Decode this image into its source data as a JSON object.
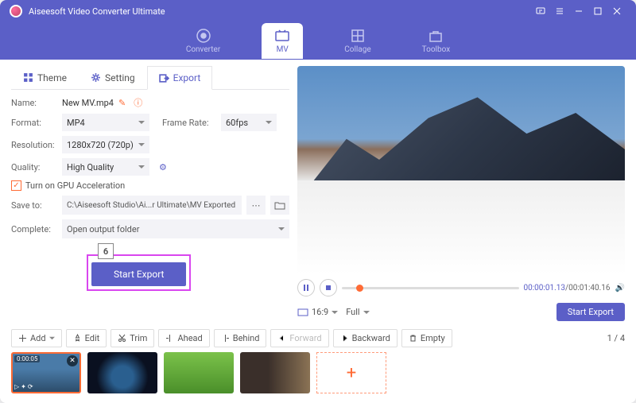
{
  "title": "Aiseesoft Video Converter Ultimate",
  "maintabs": {
    "converter": "Converter",
    "mv": "MV",
    "collage": "Collage",
    "toolbox": "Toolbox"
  },
  "subtabs": {
    "theme": "Theme",
    "setting": "Setting",
    "export": "Export"
  },
  "form": {
    "name_lbl": "Name:",
    "name_val": "New MV.mp4",
    "format_lbl": "Format:",
    "format_val": "MP4",
    "framerate_lbl": "Frame Rate:",
    "framerate_val": "60fps",
    "resolution_lbl": "Resolution:",
    "resolution_val": "1280x720 (720p)",
    "quality_lbl": "Quality:",
    "quality_val": "High Quality",
    "gpu_lbl": "Turn on GPU Acceleration",
    "saveto_lbl": "Save to:",
    "saveto_val": "C:\\Aiseesoft Studio\\Ai...r Ultimate\\MV Exported",
    "complete_lbl": "Complete:",
    "complete_val": "Open output folder"
  },
  "callout_num": "6",
  "export_btn": "Start Export",
  "player": {
    "cur": "00:00:01.13",
    "total": "/00:01:40.16",
    "aspect": "16:9",
    "full": "Full"
  },
  "export2": "Start Export",
  "toolbar": {
    "add": "Add",
    "edit": "Edit",
    "trim": "Trim",
    "ahead": "Ahead",
    "behind": "Behind",
    "forward": "Forward",
    "backward": "Backward",
    "empty": "Empty"
  },
  "pager": {
    "cur": "1",
    "total": "4"
  },
  "thumb_dur": "0:00:05"
}
